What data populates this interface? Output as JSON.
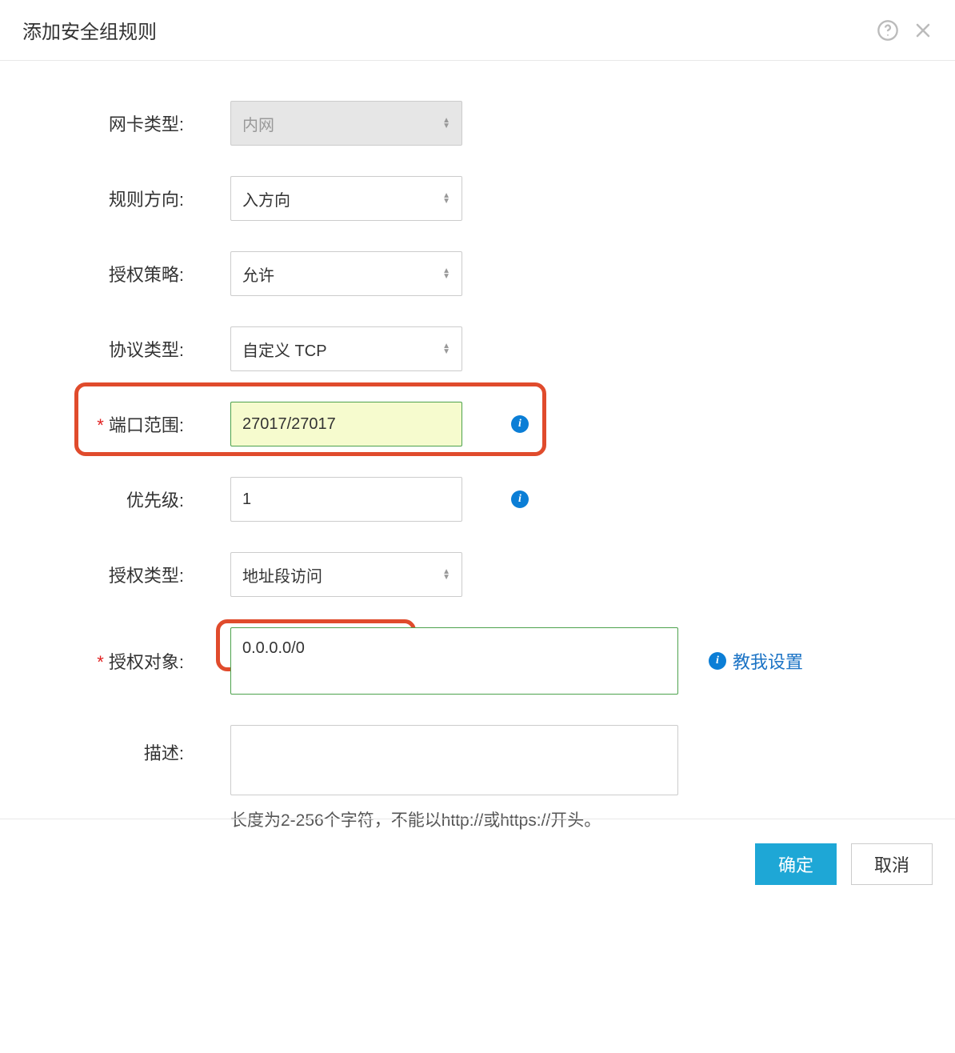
{
  "header": {
    "title": "添加安全组规则"
  },
  "form": {
    "nic_type": {
      "label": "网卡类型:",
      "value": "内网"
    },
    "direction": {
      "label": "规则方向:",
      "value": "入方向"
    },
    "policy": {
      "label": "授权策略:",
      "value": "允许"
    },
    "protocol": {
      "label": "协议类型:",
      "value": "自定义 TCP"
    },
    "port_range": {
      "label": "端口范围:",
      "value": "27017/27017"
    },
    "priority": {
      "label": "优先级:",
      "value": "1"
    },
    "auth_type": {
      "label": "授权类型:",
      "value": "地址段访问"
    },
    "auth_object": {
      "label": "授权对象:",
      "value": "0.0.0.0/0",
      "teach_link": "教我设置"
    },
    "description": {
      "label": "描述:",
      "hint": "长度为2-256个字符，不能以http://或https://开头。"
    }
  },
  "footer": {
    "confirm": "确定",
    "cancel": "取消"
  },
  "info_glyph": "i"
}
